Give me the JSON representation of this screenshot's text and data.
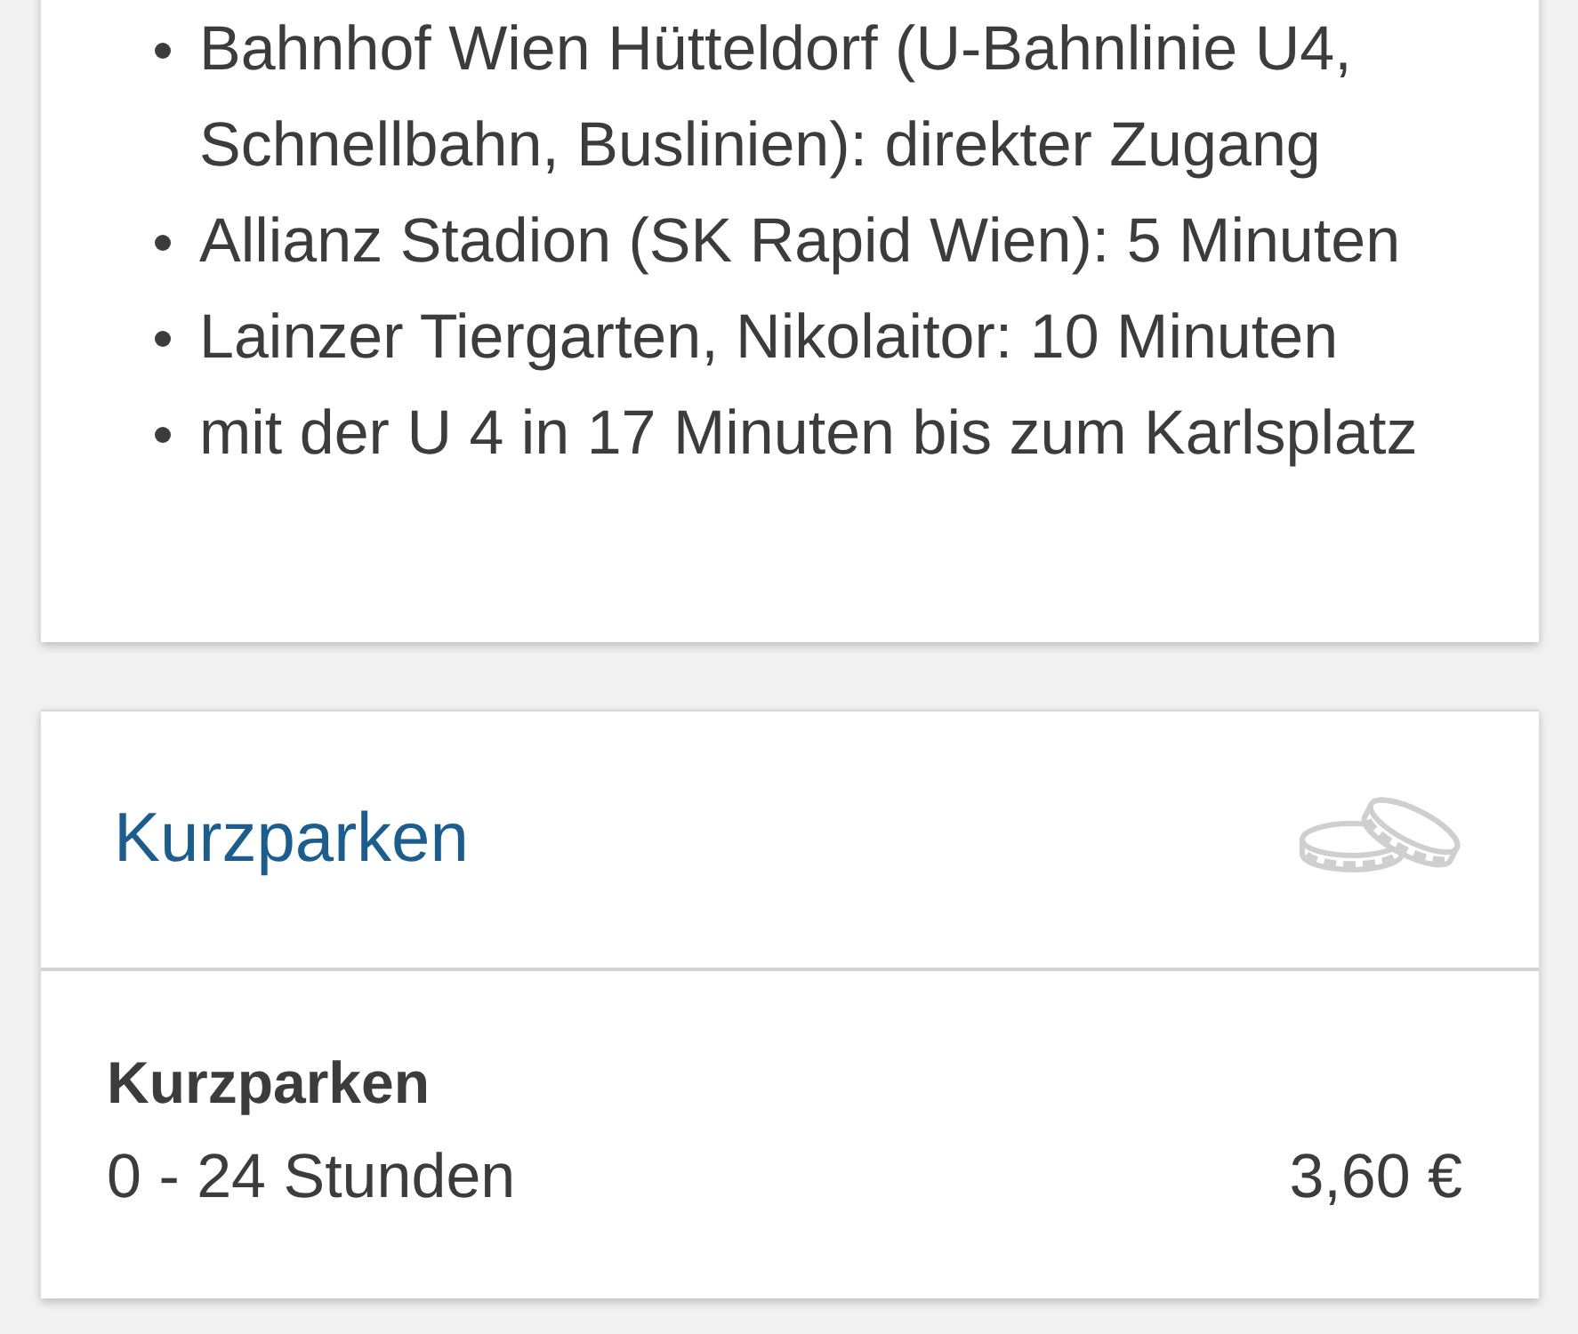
{
  "transit_card": {
    "items": [
      "Bahnhof Wien Hütteldorf (U-Bahnlinie U4, Schnellbahn, Buslinien): direkter Zugang",
      "Allianz Stadion (SK Rapid Wien): 5 Minuten",
      "Lainzer Tiergarten, Nikolaitor: 10 Minuten",
      "mit der U 4 in 17 Minuten bis zum Karlsplatz"
    ]
  },
  "parking_card": {
    "title": "Kurzparken",
    "rates": [
      {
        "name": "Kurzparken",
        "duration": "0 - 24 Stunden",
        "price": "3,60 €"
      }
    ]
  }
}
